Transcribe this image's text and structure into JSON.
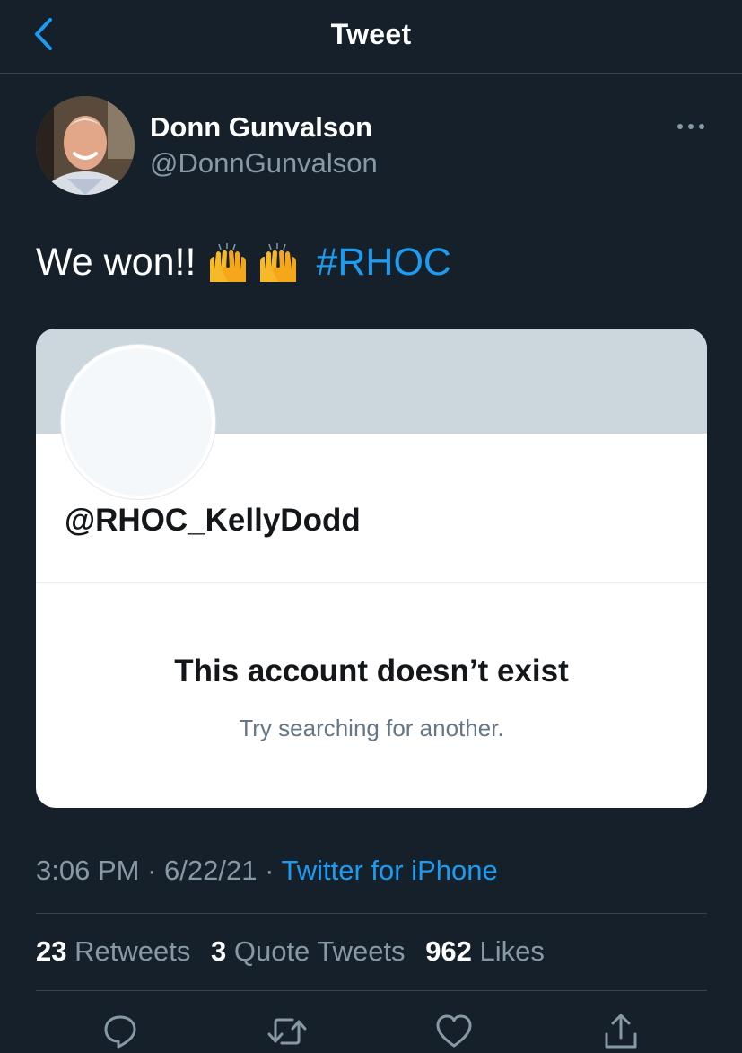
{
  "header": {
    "title": "Tweet",
    "back_icon": "chevron-left-icon"
  },
  "author": {
    "name": "Donn Gunvalson",
    "handle": "@DonnGunvalson"
  },
  "tweet": {
    "text": "We won!!",
    "emoji": "raising-hands-emoji",
    "hashtag": "#RHOC"
  },
  "card": {
    "handle": "@RHOC_KellyDodd",
    "title": "This account doesn’t exist",
    "subtitle": "Try searching for another."
  },
  "meta": {
    "time": "3:06 PM",
    "date": "6/22/21",
    "separator": "·",
    "source": "Twitter for iPhone"
  },
  "stats": {
    "retweets_count": "23",
    "retweets_label": "Retweets",
    "quotes_count": "3",
    "quotes_label": "Quote Tweets",
    "likes_count": "962",
    "likes_label": "Likes"
  },
  "actions": [
    "reply-icon",
    "retweet-icon",
    "like-icon",
    "share-icon"
  ],
  "colors": {
    "background": "#15202b",
    "accent": "#1d9bf0",
    "secondary_text": "#8899a6",
    "divider": "#38444d",
    "card_banner": "#ccd6dd"
  }
}
